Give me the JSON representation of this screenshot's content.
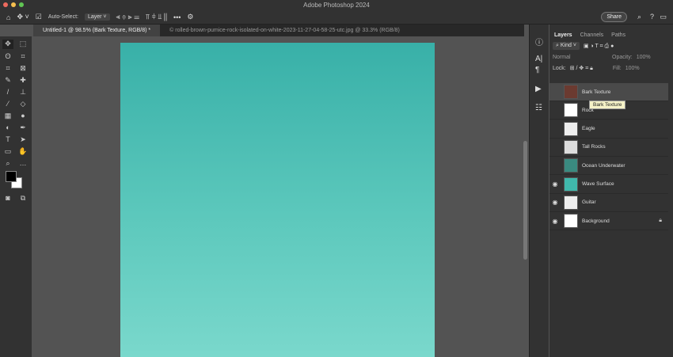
{
  "app": {
    "title": "Adobe Photoshop 2024"
  },
  "options": {
    "auto_select_label": "Auto-Select:",
    "auto_select_target": "Layer",
    "share_label": "Share"
  },
  "tabs": [
    {
      "label": "Untitled-1 @ 98.5% (Bark Texture, RGB/8) *"
    },
    {
      "label": "© rolled-brown-pumice-rock-isolated-on-white-2023-11-27-04-58-25-utc.jpg @ 33.3% (RGB/8)"
    }
  ],
  "panel": {
    "tabs": [
      "Layers",
      "Channels",
      "Paths"
    ],
    "filter": "Kind",
    "blend_mode": "Normal",
    "opacity_label": "Opacity:",
    "opacity": "100%",
    "lock_label": "Lock:",
    "fill_label": "Fill:",
    "fill": "100%"
  },
  "layers": [
    {
      "name": "Bark Texture",
      "visible": false,
      "thumb": "#6b3a30"
    },
    {
      "name": "Rock",
      "visible": false,
      "thumb": "#ffffff"
    },
    {
      "name": "Eagle",
      "visible": false,
      "thumb": "#eeeeee"
    },
    {
      "name": "Tall Rocks",
      "visible": false,
      "thumb": "#dddddd"
    },
    {
      "name": "Ocean Underwater",
      "visible": false,
      "thumb": "#3a8a80"
    },
    {
      "name": "Wave Surface",
      "visible": true,
      "thumb": "#40b8ac"
    },
    {
      "name": "Guitar",
      "visible": true,
      "thumb": "#eeeeee"
    },
    {
      "name": "Background",
      "visible": true,
      "thumb": "#ffffff"
    }
  ],
  "tooltip": "Bark Texture"
}
